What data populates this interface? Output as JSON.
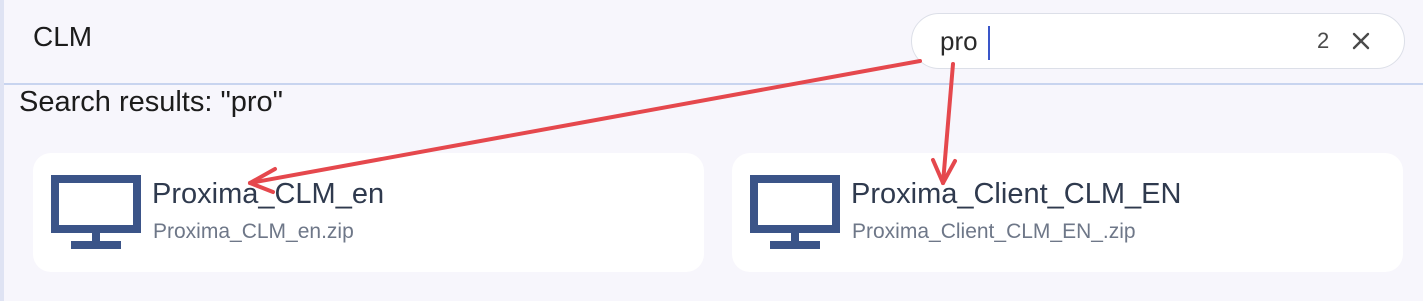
{
  "header": {
    "app_title": "CLM"
  },
  "search": {
    "value": "pro",
    "result_count": "2",
    "clear_icon": "close-icon"
  },
  "results": {
    "title": "Search results: \"pro\"",
    "items": [
      {
        "name": "Proxima_CLM_en",
        "file": "Proxima_CLM_en.zip",
        "icon": "monitor-icon"
      },
      {
        "name": "Proxima_Client_CLM_EN",
        "file": "Proxima_Client_CLM_EN_.zip",
        "icon": "monitor-icon"
      }
    ]
  },
  "colors": {
    "background": "#f7f6fc",
    "card": "#ffffff",
    "icon": "#3b5488",
    "annotation_arrow": "#e5484d"
  }
}
